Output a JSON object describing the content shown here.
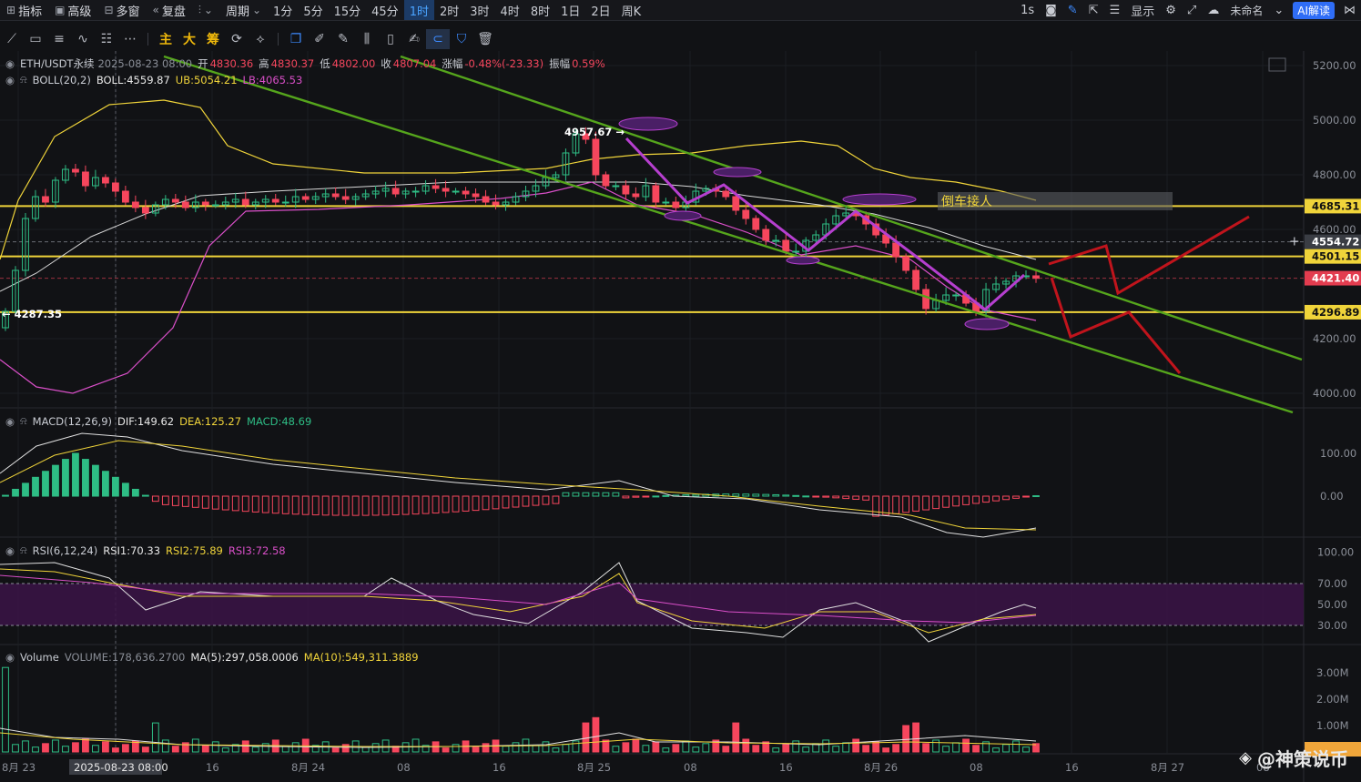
{
  "top_bar": {
    "items": [
      {
        "icon": "indicator-icon",
        "label": "指标"
      },
      {
        "icon": "advanced-icon",
        "label": "高级"
      },
      {
        "icon": "multi-window-icon",
        "label": "多窗"
      },
      {
        "icon": "replay-icon",
        "label": "复盘"
      },
      {
        "icon": "chart-type-icon",
        "label": ""
      },
      {
        "icon": "",
        "label": "周期"
      }
    ],
    "timeframes": [
      "1分",
      "5分",
      "15分",
      "45分",
      "1时",
      "2时",
      "3时",
      "4时",
      "8时",
      "1日",
      "2日",
      "周K"
    ],
    "active_timeframe": "1时",
    "right": {
      "interval": "1s",
      "display": "显示",
      "unnamed": "未命名",
      "ai": "AI解读"
    }
  },
  "header": {
    "symbol": "ETH/USDT永续",
    "datetime": "2025-08-23 08:00",
    "open_label": "开",
    "open": "4830.36",
    "high_label": "高",
    "high": "4830.37",
    "low_label": "低",
    "low": "4802.00",
    "close_label": "收",
    "close": "4807.04",
    "change_label": "涨幅",
    "change": "-0.48%(-23.33)",
    "amp_label": "振幅",
    "amp": "0.59%"
  },
  "boll": {
    "name": "BOLL(20,2)",
    "boll": "BOLL:4559.87",
    "ub": "UB:5054.21",
    "lb": "LB:4065.53"
  },
  "macd": {
    "name": "MACD(12,26,9)",
    "dif": "DIF:149.62",
    "dea": "DEA:125.27",
    "macd": "MACD:48.69"
  },
  "rsi": {
    "name": "RSI(6,12,24)",
    "rsi1": "RSI1:70.33",
    "rsi2": "RSI2:75.89",
    "rsi3": "RSI3:72.58"
  },
  "volume": {
    "name": "Volume",
    "vol": "VOLUME:178,636.2700",
    "ma5": "MA(5):297,058.0006",
    "ma10": "MA(10):549,311.3889"
  },
  "price_axis": [
    "5200.00",
    "5000.00",
    "4800.00",
    "4600.00",
    "4200.00",
    "4000.00"
  ],
  "price_tags": [
    {
      "value": "4685.31",
      "kind": "yellow"
    },
    {
      "value": "4554.72",
      "kind": "gray"
    },
    {
      "value": "4501.15",
      "kind": "yellow"
    },
    {
      "value": "4421.40",
      "kind": "red"
    },
    {
      "value": "4296.89",
      "kind": "yellow"
    }
  ],
  "macd_axis": [
    "100.00",
    "0.00"
  ],
  "rsi_axis": [
    "100.00",
    "70.00",
    "50.00",
    "30.00"
  ],
  "vol_axis": [
    "3.00M",
    "2.00M",
    "1.00M"
  ],
  "vol_tag": "",
  "time_axis": [
    "8月 23",
    "2025-08-23 08:00",
    "16",
    "8月 24",
    "08",
    "16",
    "8月 25",
    "08",
    "16",
    "8月 26",
    "08",
    "16",
    "8月 27",
    "08"
  ],
  "annotations": {
    "high_mark": "4957.67",
    "low_mark": "4287.35",
    "note": "倒车接人"
  },
  "watermark": "@神策说币",
  "colors": {
    "up": "#2ebd85",
    "down": "#f6465d",
    "yellow": "#f0d43a",
    "green_line": "#55a51c",
    "purple": "#b63fcf",
    "forecast": "#c0141c"
  }
}
